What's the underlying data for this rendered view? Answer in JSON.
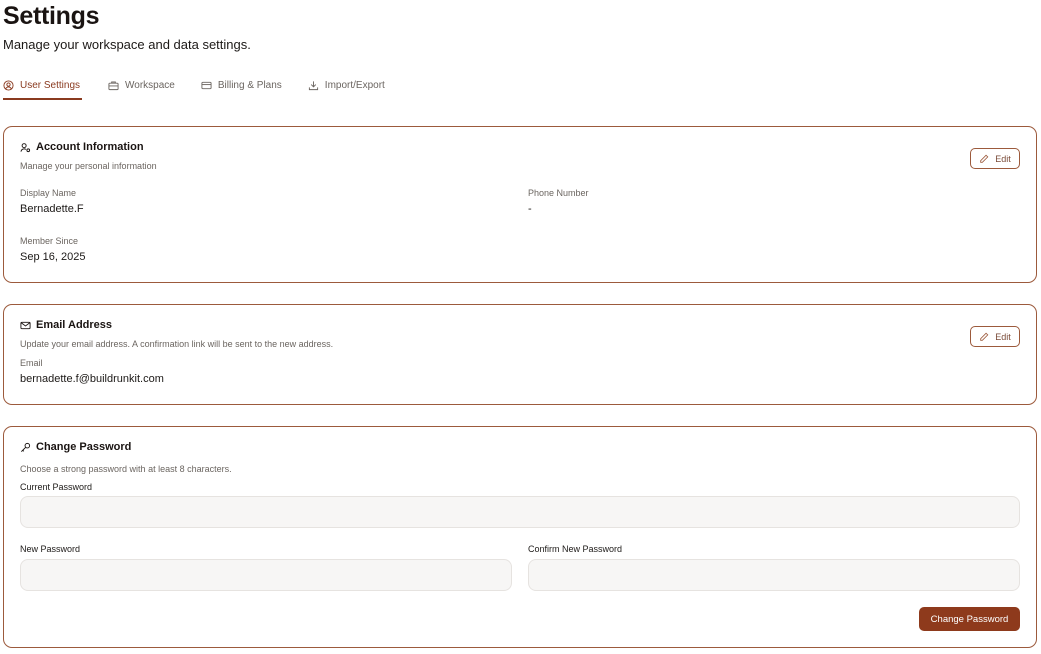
{
  "header": {
    "title": "Settings",
    "subtitle": "Manage your workspace and data settings."
  },
  "tabs": [
    {
      "label": "User Settings",
      "icon": "user-circle-icon",
      "active": true
    },
    {
      "label": "Workspace",
      "icon": "briefcase-icon",
      "active": false
    },
    {
      "label": "Billing & Plans",
      "icon": "credit-card-icon",
      "active": false
    },
    {
      "label": "Import/Export",
      "icon": "download-icon",
      "active": false
    }
  ],
  "account": {
    "title": "Account Information",
    "description": "Manage your personal information",
    "edit_label": "Edit",
    "display_name_label": "Display Name",
    "display_name": "Bernadette.F",
    "phone_label": "Phone Number",
    "phone": "-",
    "member_since_label": "Member Since",
    "member_since": "Sep 16, 2025"
  },
  "email": {
    "title": "Email Address",
    "description": "Update your email address. A confirmation link will be sent to the new address.",
    "edit_label": "Edit",
    "email_label": "Email",
    "email": "bernadette.f@buildrunkit.com"
  },
  "password": {
    "title": "Change Password",
    "description": "Choose a strong password with at least 8 characters.",
    "current_label": "Current Password",
    "current_value": "",
    "new_label": "New Password",
    "new_value": "",
    "confirm_label": "Confirm New Password",
    "confirm_value": "",
    "submit_label": "Change Password"
  },
  "colors": {
    "accent": "#8a3a1f",
    "card_border": "#9c5a3c",
    "primary_button": "#8e3a1c",
    "muted_text": "#6b6560",
    "input_bg": "#f7f6f5"
  }
}
